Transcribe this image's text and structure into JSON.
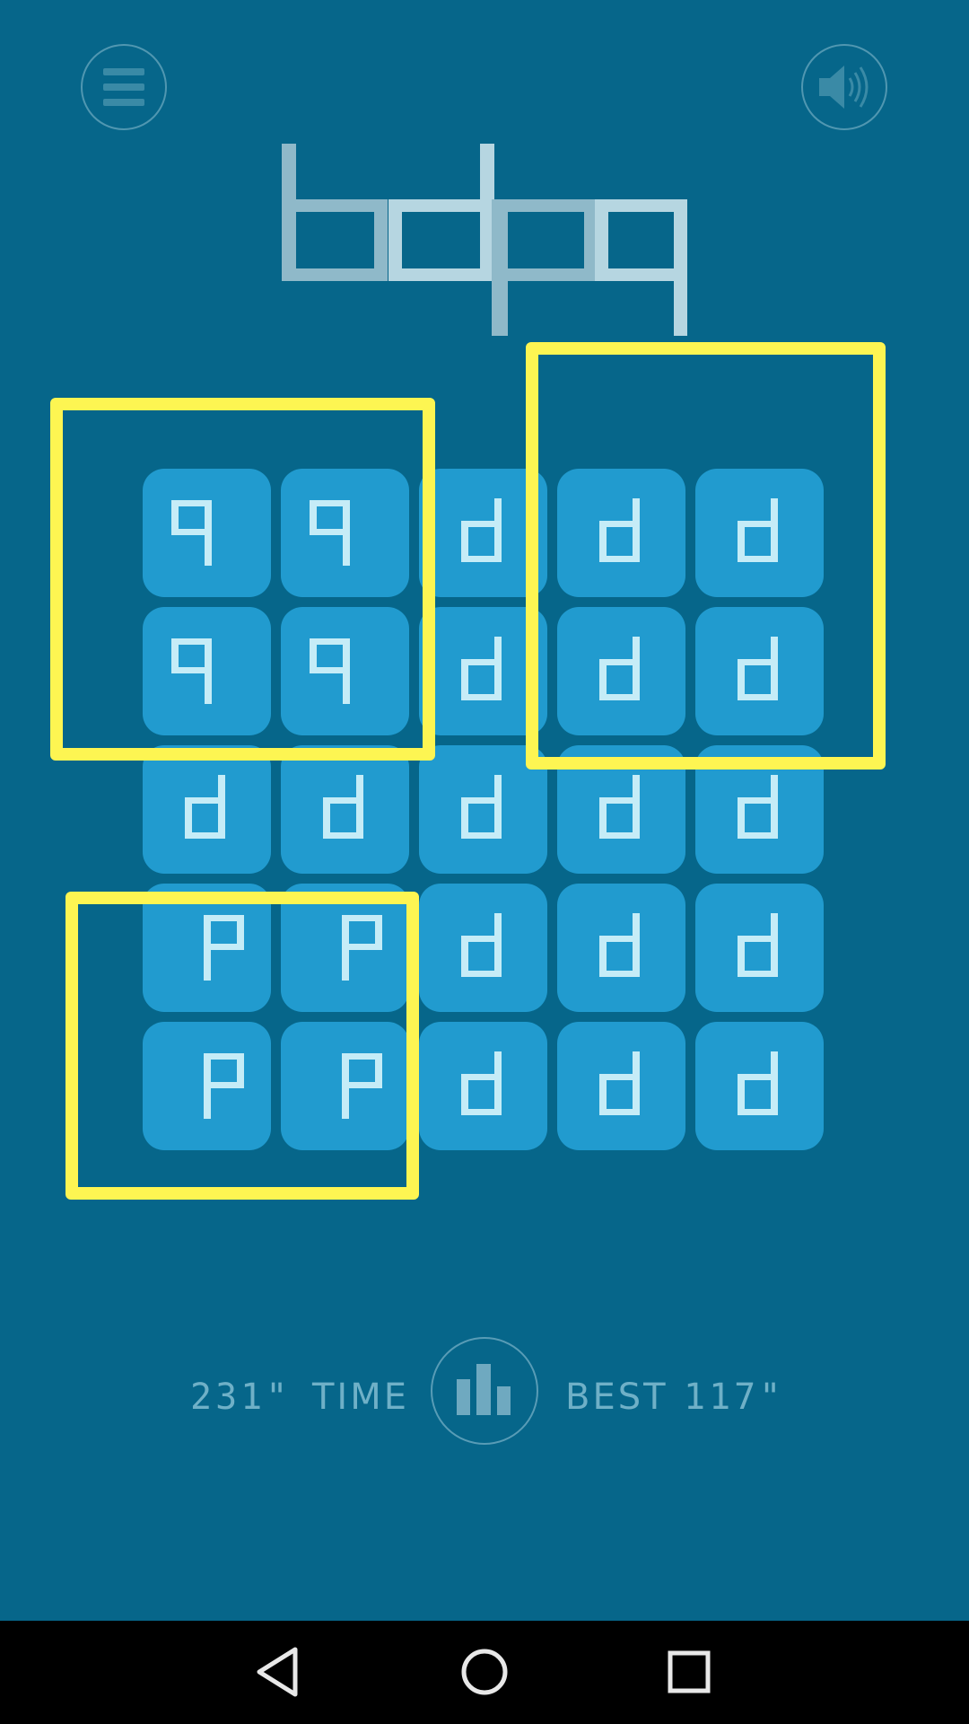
{
  "header": {
    "menu_icon": "hamburger-icon",
    "sound_icon": "speaker-on-icon",
    "title": "bdpq"
  },
  "board": {
    "rows": 5,
    "cols": 5,
    "tiles": [
      [
        "q",
        "q",
        "d",
        "d",
        "d"
      ],
      [
        "q",
        "q",
        "d",
        "d",
        "d"
      ],
      [
        "d",
        "d",
        "d",
        "d",
        "d"
      ],
      [
        "p",
        "p",
        "d",
        "d",
        "d"
      ],
      [
        "p",
        "p",
        "d",
        "d",
        "d"
      ]
    ]
  },
  "colors": {
    "background": "#06668a",
    "tile": "#219bcf",
    "glyph": "#c5ecf7",
    "highlight": "#fdf552",
    "footer_text": "#6fb0c7"
  },
  "footer": {
    "current_time": "231\"",
    "time_label": "TIME",
    "stats_icon": "bar-chart-icon",
    "best_label": "BEST",
    "best_time": "117\""
  },
  "navbar": {
    "back_icon": "back-triangle-icon",
    "home_icon": "home-circle-icon",
    "recents_icon": "recents-square-icon"
  }
}
